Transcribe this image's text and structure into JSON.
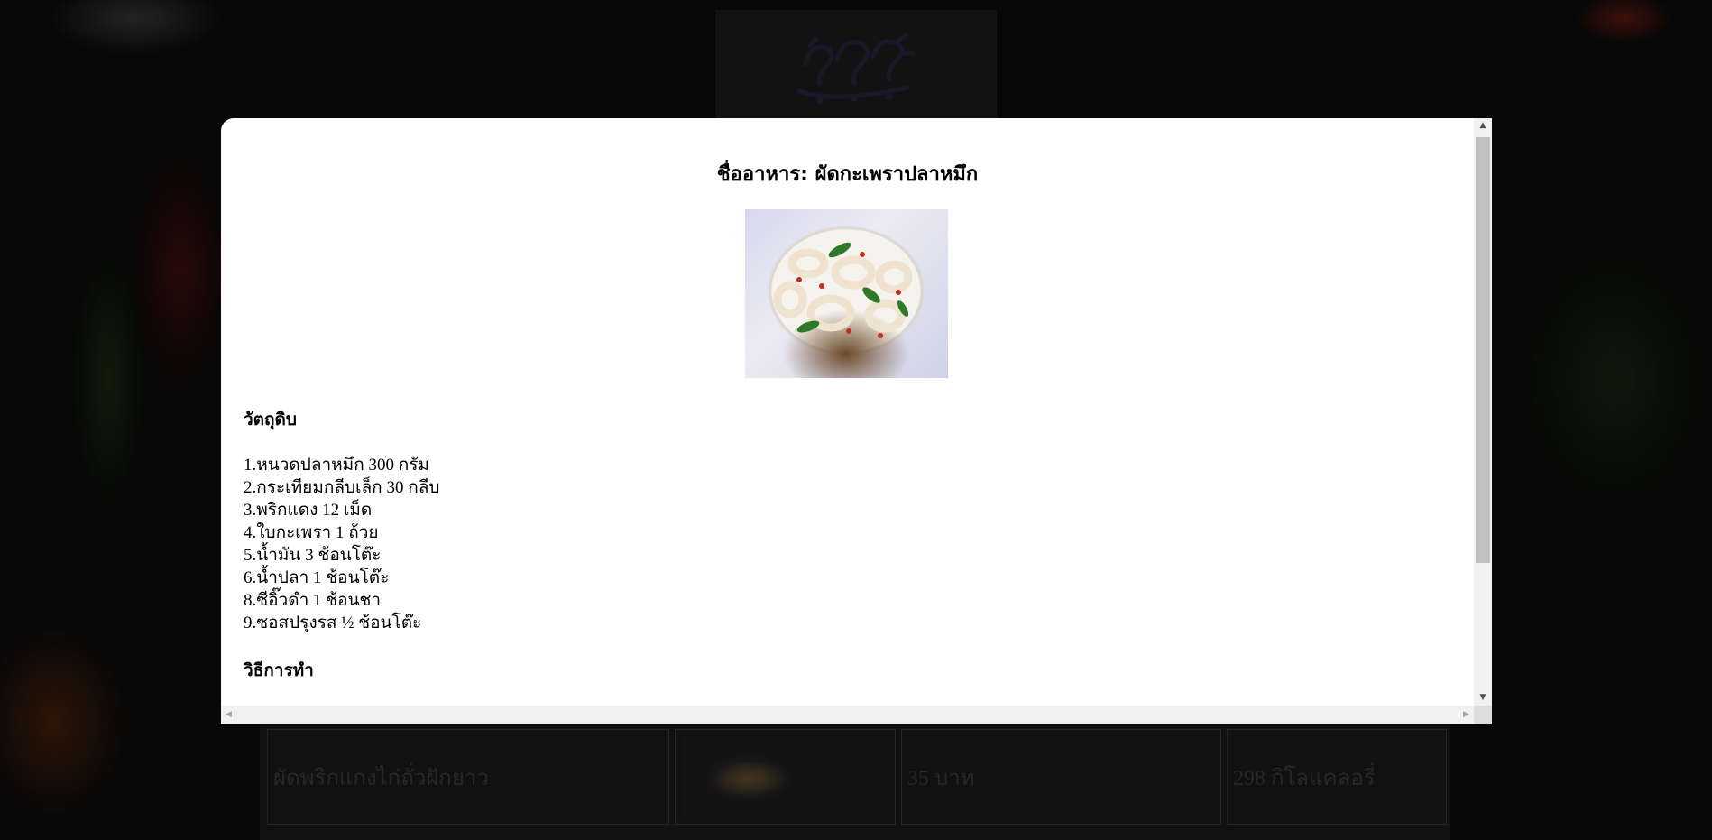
{
  "background": {
    "row": {
      "name": "ผัดพริกแกงไก่ถั่วฝักยาว",
      "price": "35 บาท",
      "calories": "298 กิโลแคลอรี่"
    }
  },
  "modal": {
    "title": "ชื่ออาหาร: ผัดกะเพราปลาหมึก",
    "ingredients_heading": "วัตถุดิบ",
    "ingredients": [
      "1.หนวดปลาหมึก 300 กรัม",
      "2.กระเทียมกลีบเล็ก 30 กลีบ",
      "3.พริกแดง 12 เม็ด",
      "4.ใบกะเพรา 1 ถ้วย",
      "5.น้ำมัน 3 ช้อนโต๊ะ",
      "6.น้ำปลา 1 ช้อนโต๊ะ",
      "8.ซีอิ๊วดำ 1 ช้อนชา",
      "9.ซอสปรุงรส ½ ช้อนโต๊ะ"
    ],
    "method_heading": "วิธีการทำ"
  },
  "colors": {
    "page_background": "#0b0b0b",
    "modal_background": "#ffffff",
    "scroll_thumb": "#c1c1c1"
  }
}
